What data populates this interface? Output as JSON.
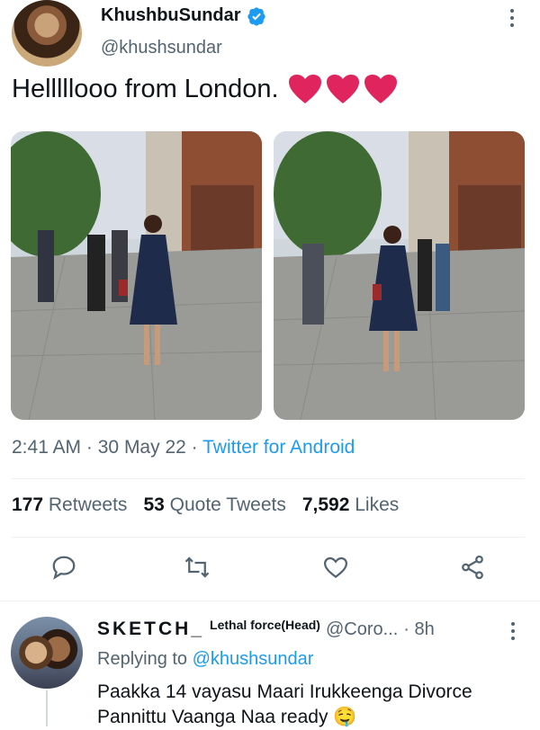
{
  "tweet": {
    "display_name": "KhushbuSundar",
    "handle": "@khushsundar",
    "text": "Helllllooo from London.",
    "emoji": "❤️❤️❤️",
    "time": "2:41 AM",
    "date": "30 May 22",
    "source": "Twitter for Android",
    "dot": "·"
  },
  "stats": {
    "retweets_count": "177",
    "retweets_label": "Retweets",
    "quote_count": "53",
    "quote_label": "Quote Tweets",
    "likes_count": "7,592",
    "likes_label": "Likes"
  },
  "icons": {
    "reply": "comment-icon",
    "retweet": "retweet-icon",
    "like": "heart-icon",
    "share": "share-icon",
    "verified": "verified-badge-icon",
    "more": "more-vertical-icon"
  },
  "reply": {
    "display_name": "SKETCH_",
    "superscript": "Lethal force(Head)",
    "handle": "@Coro...",
    "time": "· 8h",
    "replying_prefix": "Replying to",
    "replying_to": "@khushsundar",
    "text": "Paakka 14 vayasu Maari Irukkeenga Divorce Pannittu Vaanga Naa ready 🤤"
  },
  "colors": {
    "accent": "#1d9bf0",
    "muted": "#536471",
    "heart": "#e0245e"
  }
}
